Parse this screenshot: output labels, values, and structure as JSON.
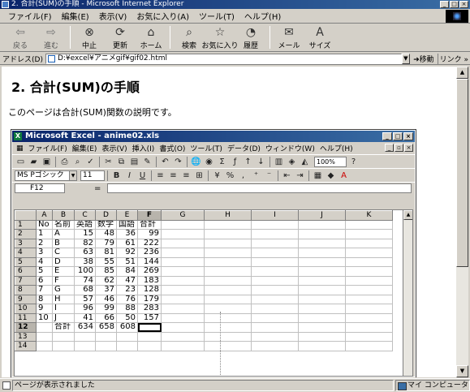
{
  "window": {
    "title": "2. 合計(SUM)の手順 - Microsoft Internet Explorer"
  },
  "menu": [
    "ファイル(F)",
    "編集(E)",
    "表示(V)",
    "お気に入り(A)",
    "ツール(T)",
    "ヘルプ(H)"
  ],
  "toolbar": [
    {
      "label": "戻る",
      "icon": "back-arrow-icon",
      "glyph": "⇦"
    },
    {
      "label": "進む",
      "icon": "forward-arrow-icon",
      "glyph": "⇨"
    },
    {
      "label": "中止",
      "icon": "stop-icon",
      "glyph": "⊗"
    },
    {
      "label": "更新",
      "icon": "refresh-icon",
      "glyph": "⟳"
    },
    {
      "label": "ホーム",
      "icon": "home-icon",
      "glyph": "⌂"
    },
    {
      "label": "検索",
      "icon": "search-icon",
      "glyph": "⌕"
    },
    {
      "label": "お気に入り",
      "icon": "favorites-icon",
      "glyph": "☆"
    },
    {
      "label": "履歴",
      "icon": "history-icon",
      "glyph": "◔"
    },
    {
      "label": "メール",
      "icon": "mail-icon",
      "glyph": "✉"
    },
    {
      "label": "サイズ",
      "icon": "font-size-icon",
      "glyph": "A"
    }
  ],
  "address": {
    "label": "アドレス(D)",
    "value": "D:¥excel¥アニメgif¥gif02.html",
    "go_label": "移動",
    "links_label": "リンク »"
  },
  "page": {
    "heading": "2. 合計(SUM)の手順",
    "description": "このページは合計(SUM)関数の説明です。"
  },
  "excel": {
    "title": "Microsoft Excel - anime02.xls",
    "menu": [
      "ファイル(F)",
      "編集(E)",
      "表示(V)",
      "挿入(I)",
      "書式(O)",
      "ツール(T)",
      "データ(D)",
      "ウィンドウ(W)",
      "ヘルプ(H)"
    ],
    "zoom": "100%",
    "font_name": "MS Pゴシック",
    "font_size": "11",
    "name_box": "F12",
    "formula_eq": "=",
    "columns": [
      "A",
      "B",
      "C",
      "D",
      "E",
      "F",
      "G",
      "H",
      "I",
      "J",
      "K"
    ],
    "rows": [
      [
        "No",
        "名前",
        "英語",
        "数学",
        "国語",
        "合計",
        "",
        "",
        "",
        "",
        ""
      ],
      [
        "1",
        "A",
        "15",
        "48",
        "36",
        "99",
        "",
        "",
        "",
        "",
        ""
      ],
      [
        "2",
        "B",
        "82",
        "79",
        "61",
        "222",
        "",
        "",
        "",
        "",
        ""
      ],
      [
        "3",
        "C",
        "63",
        "81",
        "92",
        "236",
        "",
        "",
        "",
        "",
        ""
      ],
      [
        "4",
        "D",
        "38",
        "55",
        "51",
        "144",
        "",
        "",
        "",
        "",
        ""
      ],
      [
        "5",
        "E",
        "100",
        "85",
        "84",
        "269",
        "",
        "",
        "",
        "",
        ""
      ],
      [
        "6",
        "F",
        "74",
        "62",
        "47",
        "183",
        "",
        "",
        "",
        "",
        ""
      ],
      [
        "7",
        "G",
        "68",
        "37",
        "23",
        "128",
        "",
        "",
        "",
        "",
        ""
      ],
      [
        "8",
        "H",
        "57",
        "46",
        "76",
        "179",
        "",
        "",
        "",
        "",
        ""
      ],
      [
        "9",
        "I",
        "96",
        "99",
        "88",
        "283",
        "",
        "",
        "",
        "",
        ""
      ],
      [
        "10",
        "J",
        "41",
        "66",
        "50",
        "157",
        "",
        "",
        "",
        "",
        ""
      ],
      [
        "",
        "合計",
        "634",
        "658",
        "608",
        "",
        "",
        "",
        "",
        "",
        ""
      ],
      [
        "",
        "",
        "",
        "",
        "",
        "",
        "",
        "",
        "",
        "",
        ""
      ],
      [
        "",
        "",
        "",
        "",
        "",
        "",
        "",
        "",
        "",
        "",
        ""
      ]
    ],
    "selected_row": 12,
    "selected_col": 5
  },
  "status": {
    "message": "ページが表示されました",
    "zone": "マイ コンピュータ"
  }
}
